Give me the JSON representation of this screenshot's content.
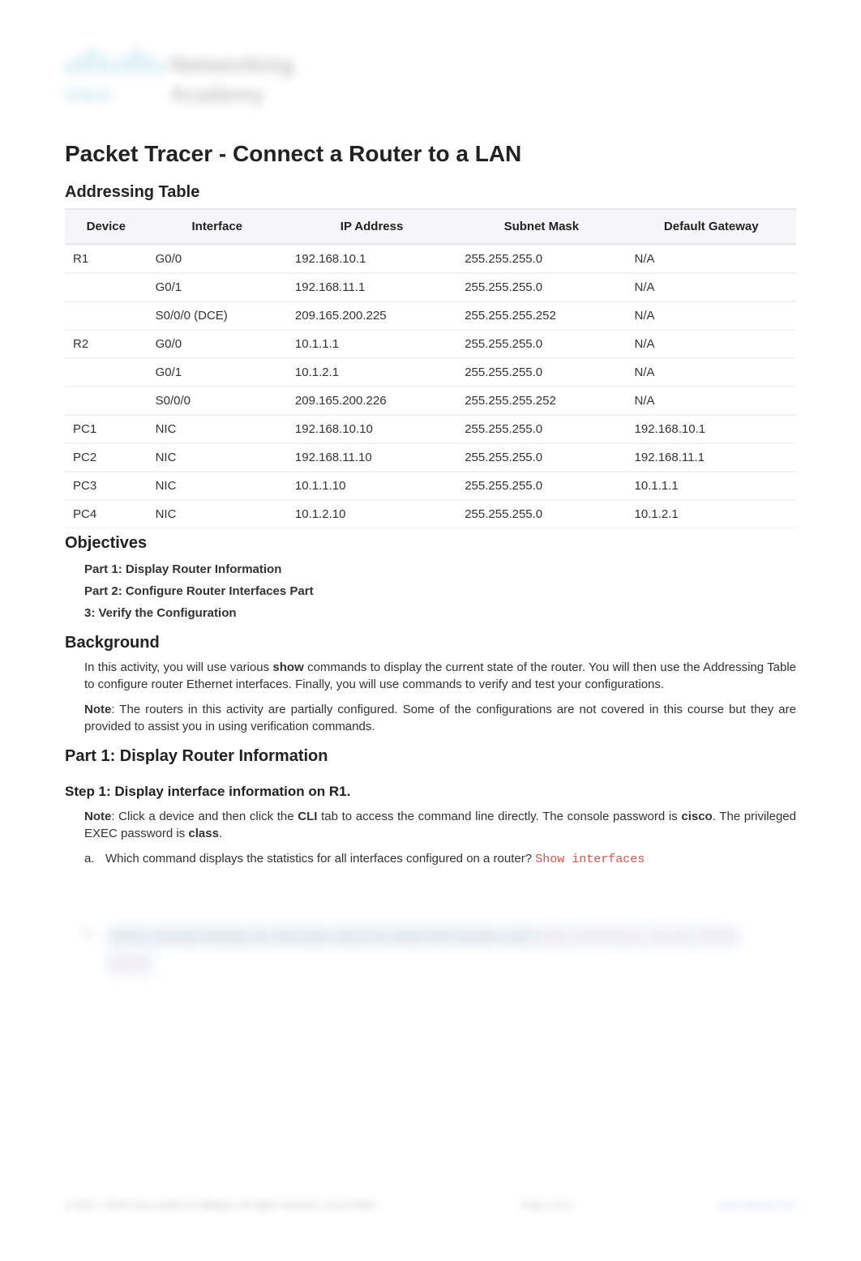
{
  "logo": {
    "brand": "cisco",
    "line1": "Networking",
    "line2": "Academy"
  },
  "main_title": "Packet Tracer - Connect a Router to a LAN",
  "addressing_table": {
    "heading": "Addressing Table",
    "headers": [
      "Device",
      "Interface",
      "IP Address",
      "Subnet Mask",
      "Default Gateway"
    ],
    "rows": [
      {
        "device": "R1",
        "interface": "G0/0",
        "ip": "192.168.10.1",
        "mask": "255.255.255.0",
        "gw": "N/A"
      },
      {
        "device": "",
        "interface": "G0/1",
        "ip": "192.168.11.1",
        "mask": "255.255.255.0",
        "gw": "N/A"
      },
      {
        "device": "",
        "interface": "S0/0/0 (DCE)",
        "ip": "209.165.200.225",
        "mask": "255.255.255.252",
        "gw": "N/A"
      },
      {
        "device": "R2",
        "interface": "G0/0",
        "ip": "10.1.1.1",
        "mask": "255.255.255.0",
        "gw": "N/A"
      },
      {
        "device": "",
        "interface": "G0/1",
        "ip": "10.1.2.1",
        "mask": "255.255.255.0",
        "gw": "N/A"
      },
      {
        "device": "",
        "interface": "S0/0/0",
        "ip": "209.165.200.226",
        "mask": "255.255.255.252",
        "gw": "N/A"
      },
      {
        "device": "PC1",
        "interface": "NIC",
        "ip": "192.168.10.10",
        "mask": "255.255.255.0",
        "gw": "192.168.10.1"
      },
      {
        "device": "PC2",
        "interface": "NIC",
        "ip": "192.168.11.10",
        "mask": "255.255.255.0",
        "gw": "192.168.11.1"
      },
      {
        "device": "PC3",
        "interface": "NIC",
        "ip": "10.1.1.10",
        "mask": "255.255.255.0",
        "gw": "10.1.1.1"
      },
      {
        "device": "PC4",
        "interface": "NIC",
        "ip": "10.1.2.10",
        "mask": "255.255.255.0",
        "gw": "10.1.2.1"
      }
    ]
  },
  "objectives": {
    "heading": "Objectives",
    "items": [
      "Part 1: Display Router Information",
      "Part 2: Configure Router Interfaces Part",
      "3: Verify the Configuration"
    ]
  },
  "background": {
    "heading": "Background",
    "para1_pre": "In this activity, you will use various ",
    "para1_bold": "show",
    "para1_post": " commands to display the current state of the router. You will then use the Addressing Table to configure router Ethernet interfaces. Finally, you will use commands to verify and test your configurations.",
    "note_bold": "Note",
    "note_text": ": The routers in this activity are partially configured. Some of the configurations are not covered in this course but they are provided to assist you in using verification commands."
  },
  "part1": {
    "heading": "Part 1: Display Router Information",
    "step1_heading": "Step 1: Display interface information on R1.",
    "note_bold": "Note",
    "note_seg1": ": Click a device and then click the ",
    "note_cli": "CLI",
    "note_seg2": " tab to access the command line directly. The console password is ",
    "note_cisco": "cisco",
    "note_seg3": ". The privileged EXEC password is ",
    "note_class": "class",
    "note_seg4": ".",
    "q_a_letter": "a.",
    "q_a_text": "Which command displays the statistics for all interfaces configured on a router? ",
    "q_a_answer": "Show interfaces"
  },
  "blur": {
    "b_letter": "b.",
    "b_text_part1": "Which command displays the information about the Serial 0/0/0 interface only?",
    "b_answer": "Show interface serial 0/0/0",
    "b_line2": "0/0/0"
  },
  "footer": {
    "left": "© 2013 - 2018 Cisco and/or its affiliates. All rights reserved. Cisco Public",
    "center": "Page 1 of 4",
    "right": "www.netacad.com"
  }
}
